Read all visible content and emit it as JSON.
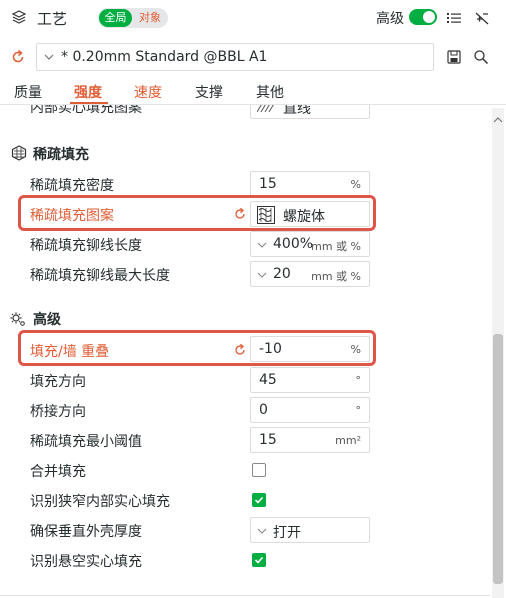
{
  "header": {
    "title": "工艺",
    "scope_global": "全局",
    "scope_object": "对象",
    "advanced_label": "高级",
    "advanced_on": true,
    "icons": [
      "layers-icon",
      "list-icon",
      "compare-icon"
    ]
  },
  "preset": {
    "name": "* 0.20mm Standard @BBL A1",
    "icons": [
      "undo-icon",
      "chevron-down-icon",
      "save-icon",
      "search-icon"
    ]
  },
  "tabs": [
    {
      "label": "质量"
    },
    {
      "label": "强度"
    },
    {
      "label": "速度"
    },
    {
      "label": "支撑"
    },
    {
      "label": "其他"
    }
  ],
  "cut_row": {
    "label": "内部实心填充图案",
    "value": "直线"
  },
  "sparse": {
    "title": "稀疏填充",
    "rows": {
      "density": {
        "label": "稀疏填充密度",
        "value": "15",
        "unit": "%"
      },
      "pattern": {
        "label": "稀疏填充图案",
        "value": "螺旋体"
      },
      "anchor": {
        "label": "稀疏填充铆线长度",
        "value": "400%",
        "unit": "mm 或 %"
      },
      "anchor_max": {
        "label": "稀疏填充铆线最大长度",
        "value": "20",
        "unit": "mm 或 %"
      }
    }
  },
  "advanced": {
    "title": "高级",
    "rows": {
      "overlap": {
        "label": "填充/墙 重叠",
        "value": "-10",
        "unit": "%"
      },
      "direction": {
        "label": "填充方向",
        "value": "45",
        "unit": "°"
      },
      "bridge": {
        "label": "桥接方向",
        "value": "0",
        "unit": "°"
      },
      "min_area": {
        "label": "稀疏填充最小阈值",
        "value": "15",
        "unit": "mm²"
      },
      "combine": {
        "label": "合并填充",
        "checked": false
      },
      "narrow": {
        "label": "识别狭窄内部实心填充",
        "checked": true
      },
      "vertical": {
        "label": "确保垂直外壳厚度",
        "value": "打开"
      },
      "overhang": {
        "label": "识别悬空实心填充",
        "checked": true
      }
    }
  },
  "colors": {
    "accent": "#00ae42",
    "highlight": "#e05d35",
    "outline": "#e0554a"
  }
}
